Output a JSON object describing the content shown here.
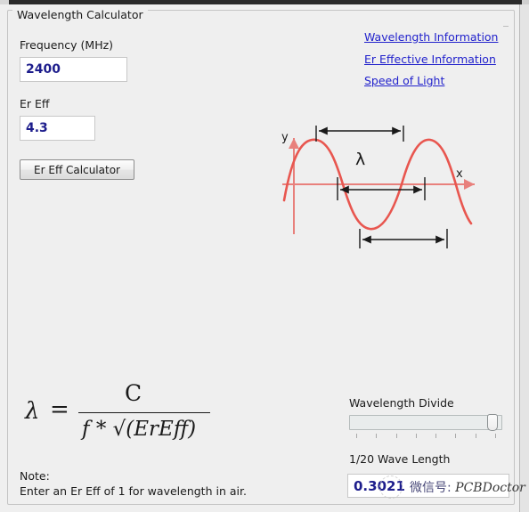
{
  "window": {
    "groupbox_title": "Wavelength Calculator"
  },
  "form": {
    "frequency_label": "Frequency (MHz)",
    "frequency_value": "2400",
    "frequency_placeholder": "",
    "ereff_label": "Er Eff",
    "ereff_value": "4.3",
    "ereff_placeholder": "",
    "calculator_button": "Er Eff Calculator"
  },
  "links": [
    {
      "label": "Wavelength Information"
    },
    {
      "label": "Er Effective Information"
    },
    {
      "label": "Speed of Light"
    }
  ],
  "diagram": {
    "y_axis_label": "y",
    "x_axis_label": "x",
    "lambda_label": "λ",
    "wave_color": "#e8564f",
    "axis_color": "#e8807c",
    "arrow_color": "#1a1a1a"
  },
  "formula": {
    "lambda": "λ",
    "equals": "=",
    "numerator": "C",
    "denominator_f": "f",
    "denominator_op": "*",
    "radical": "√",
    "denominator_radicand": "(ErEff)",
    "denominator_text": "f * √(ErEff)"
  },
  "note": {
    "title": "Note:",
    "body": "Enter an Er Eff of 1 for wavelength in air."
  },
  "results": {
    "divide_label": "Wavelength Divide",
    "slider_value": "20",
    "slider_min": "1",
    "slider_max": "20",
    "slider_tick_count": 8,
    "wavelength_label": "1/20 Wave Length",
    "wavelength_value": "0.3021",
    "wavelength_placeholder": ""
  },
  "watermark": {
    "text_cjk": "微信号: ",
    "text_latin": "PCBDoctor"
  },
  "colors": {
    "background": "#efefef",
    "input_text": "#1d1d8c",
    "link": "#2222cc",
    "wave": "#e8564f"
  }
}
